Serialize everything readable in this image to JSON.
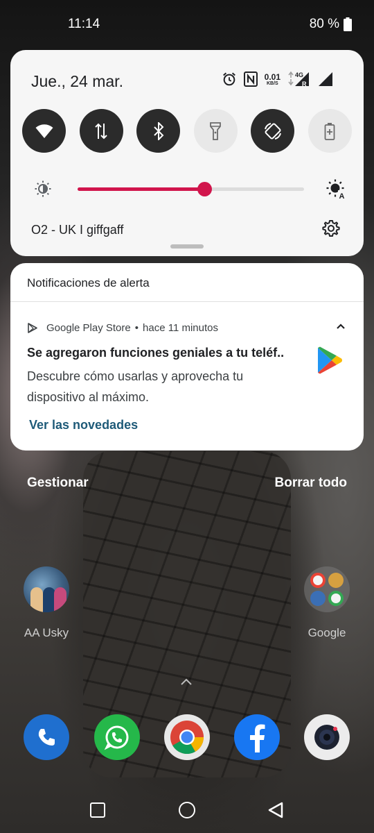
{
  "status_bar": {
    "time": "11:14",
    "battery_text": "80 %"
  },
  "quick_settings": {
    "date": "Jue., 24 mar.",
    "data_rate_value": "0.01",
    "data_rate_unit": "KB/S",
    "network_label": "4G",
    "roaming_label": "R",
    "tiles": [
      {
        "name": "wifi",
        "state": "on"
      },
      {
        "name": "mobile-data",
        "state": "on"
      },
      {
        "name": "bluetooth",
        "state": "on"
      },
      {
        "name": "flashlight",
        "state": "off"
      },
      {
        "name": "auto-rotate",
        "state": "on"
      },
      {
        "name": "battery-saver",
        "state": "off"
      }
    ],
    "brightness_level": 0.56,
    "carrier": "O2 - UK I giffgaff"
  },
  "notification": {
    "section_header": "Notificaciones de alerta",
    "app_name": "Google Play Store",
    "separator": "•",
    "time": "hace 11 minutos",
    "title": "Se agregaron funciones geniales a tu teléf..",
    "body": "Descubre cómo usarlas y aprovecha tu dispositivo al máximo.",
    "action": "Ver las novedades"
  },
  "actions": {
    "manage": "Gestionar",
    "clear_all": "Borrar todo"
  },
  "home": {
    "apps": [
      {
        "label": "AA Usky"
      },
      {
        "label": "Google"
      }
    ],
    "dock": [
      "phone",
      "whatsapp",
      "chrome",
      "facebook",
      "camera"
    ]
  },
  "colors": {
    "accent": "#d1154c",
    "tile_on": "#2b2b2b",
    "tile_off": "#e8e8e8",
    "action_text": "#1e5a78"
  }
}
